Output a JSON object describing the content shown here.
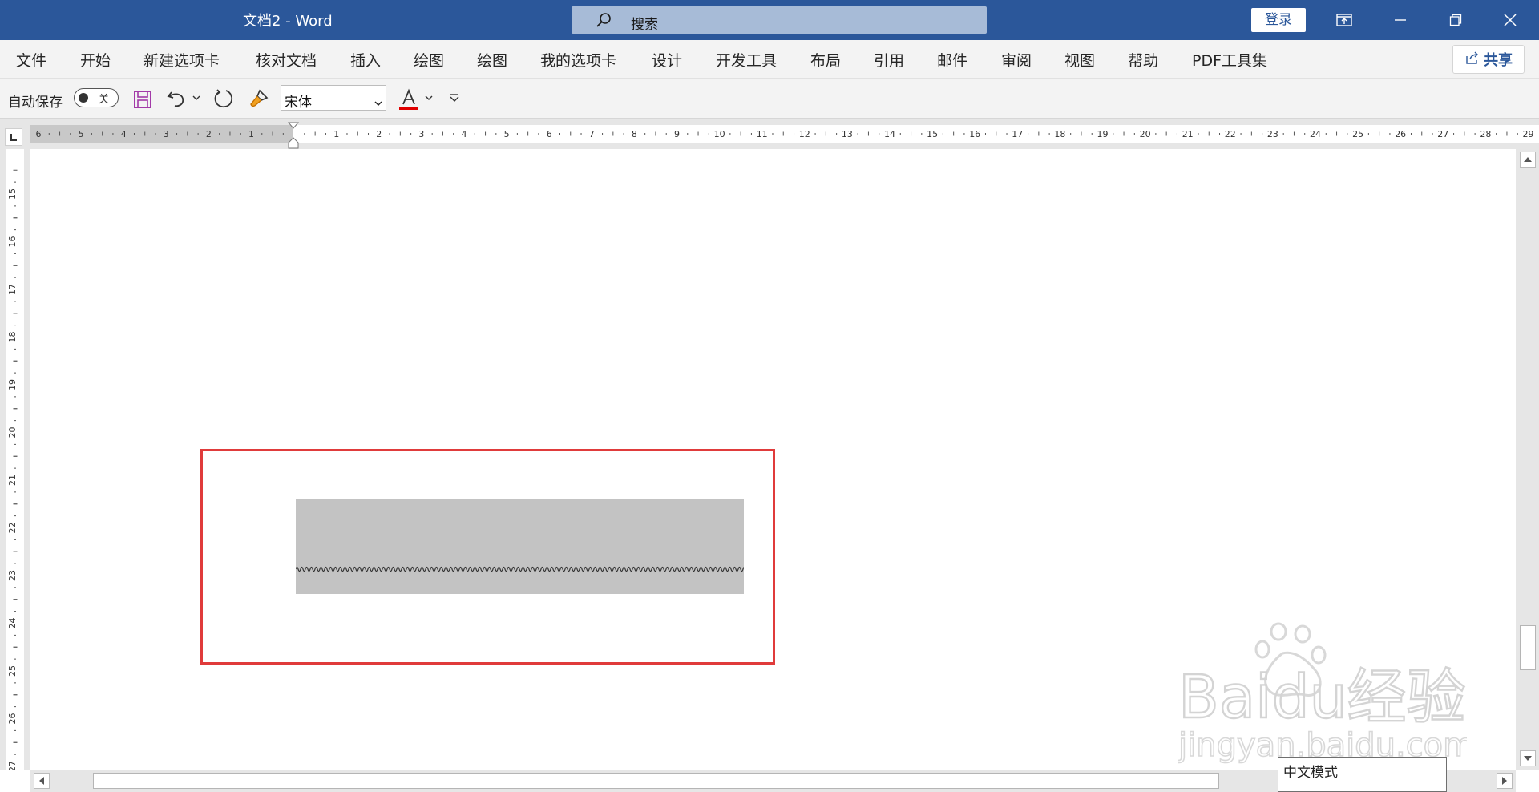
{
  "app": {
    "title": "文档2  -  Word",
    "search_placeholder": "搜索",
    "login_label": "登录"
  },
  "menu": {
    "items": [
      "文件",
      "开始",
      "新建选项卡",
      "核对文档",
      "插入",
      "绘图",
      "绘图",
      "我的选项卡",
      "设计",
      "开发工具",
      "布局",
      "引用",
      "邮件",
      "审阅",
      "视图",
      "帮助",
      "PDF工具集"
    ],
    "share_label": "共享"
  },
  "toolbar": {
    "autosave_label": "自动保存",
    "autosave_state": "关",
    "font_name": "宋体",
    "font_color": "#e00000"
  },
  "ruler": {
    "h_labels": [
      "6",
      "5",
      "4",
      "3",
      "2",
      "1",
      "",
      "1",
      "2",
      "3",
      "4",
      "5",
      "6",
      "7",
      "8",
      "9",
      "10",
      "11",
      "12",
      "13",
      "14",
      "15",
      "16",
      "17",
      "18",
      "19",
      "20",
      "21",
      "22",
      "23",
      "24",
      "25",
      "26",
      "27",
      "28",
      "29"
    ],
    "v_labels": [
      "15",
      "16",
      "17",
      "18",
      "19",
      "20",
      "21",
      "22",
      "23",
      "24",
      "25",
      "26",
      "27"
    ]
  },
  "document": {
    "highlight_color": "#e03b3b",
    "block_color": "#c3c3c3"
  },
  "statusbar": {
    "ime_label": "中文模式"
  },
  "watermark": {
    "brand": "Baidu经验",
    "url": "jingyan.baidu.com"
  },
  "colors": {
    "titlebar": "#2b579a",
    "ribbon": "#f3f3f3"
  }
}
